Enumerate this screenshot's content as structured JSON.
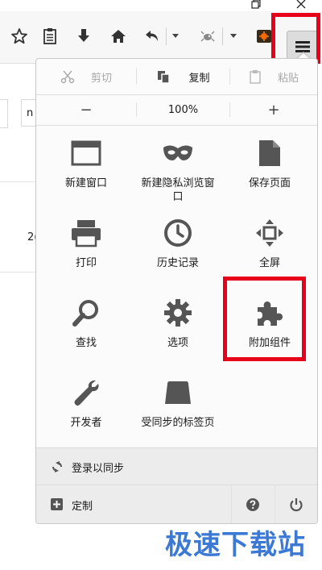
{
  "colors": {
    "highlight": "#e8001a",
    "icon_gray": "#555555",
    "panel_bg": "#fbfbfb",
    "footer_bg": "#ececec",
    "watermark": "#3b79d4",
    "addon_icon": "#ff6a00"
  },
  "toolbar": {
    "icons": [
      "star-icon",
      "reading-list-icon",
      "download-icon",
      "home-icon",
      "back-arrow-icon",
      "bug-addon-icon",
      "addon-orange-icon",
      "hamburger-menu-icon"
    ]
  },
  "edit": {
    "cut": "剪切",
    "copy": "复制",
    "paste": "粘贴"
  },
  "zoom": {
    "minus": "−",
    "level": "100%",
    "plus": "+"
  },
  "grid": {
    "new_window": "新建窗口",
    "private_window": "新建隐私浏览窗口",
    "save_page": "保存页面",
    "print": "打印",
    "history": "历史记录",
    "fullscreen": "全屏",
    "find": "查找",
    "options": "选项",
    "addons": "附加组件",
    "developer": "开发者",
    "synced_tabs": "受同步的标签页"
  },
  "sync": {
    "label": "登录以同步"
  },
  "footer": {
    "customize": "定制"
  },
  "page": {
    "partial_text_1": "n",
    "partial_text_2": "2("
  },
  "watermark": "极速下载站"
}
